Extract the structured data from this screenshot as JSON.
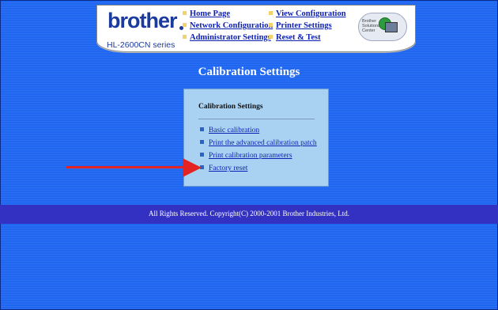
{
  "header": {
    "logo": "brother",
    "model": "HL-2600CN series",
    "nav": {
      "home": "Home Page",
      "network_config": "Network Configuration",
      "admin_settings": "Administrator Settings",
      "view_config": "View Configuration",
      "printer_settings": "Printer Settings",
      "reset_test": "Reset & Test"
    },
    "solutions_center": [
      "Brother",
      "Solutions",
      "Center"
    ]
  },
  "page_title": "Calibration Settings",
  "panel": {
    "heading": "Calibration Settings",
    "links": [
      "Basic calibration",
      "Print the advanced calibration patch",
      "Print calibration parameters",
      "Factory reset"
    ]
  },
  "footer": {
    "copyright": "All Rights Reserved. Copyright(C) 2000-2001 Brother Industries, Ltd."
  },
  "colors": {
    "background": "#1f66f0",
    "panel": "#a9d2f2",
    "footer_band": "#3331c2",
    "arrow": "#e42323",
    "link": "#0b1fb0"
  }
}
